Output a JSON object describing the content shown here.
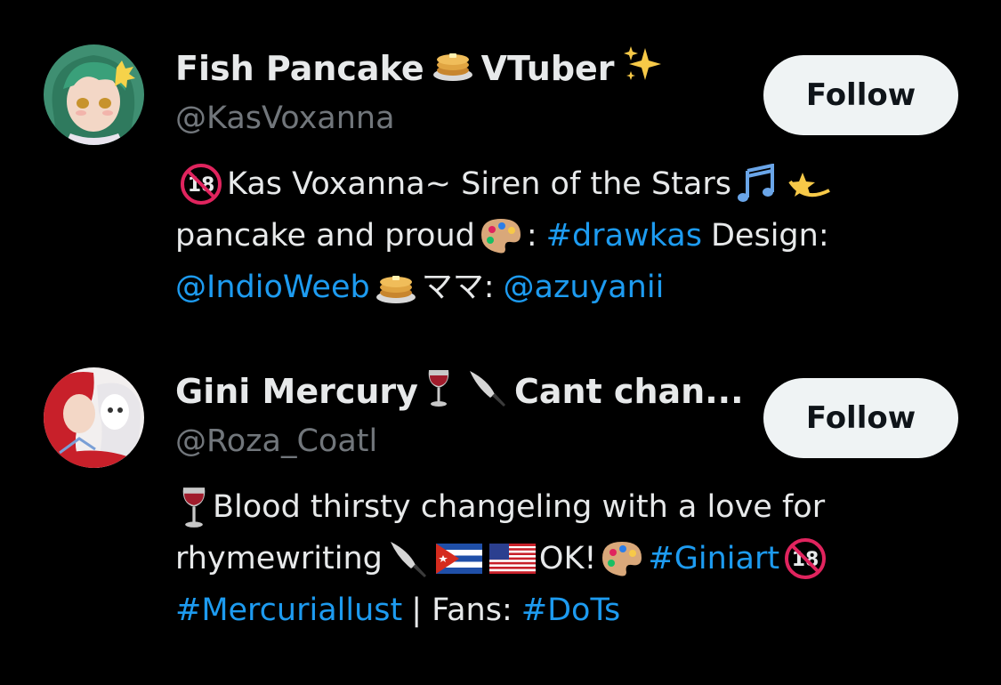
{
  "users": [
    {
      "name_part1": "Fish Pancake",
      "name_part2": "VTuber",
      "name_emoji": [
        "pancake-icon",
        "sparkles-icon"
      ],
      "handle": "@KasVoxanna",
      "follow_label": "Follow",
      "bio": {
        "l1_text": "Kas Voxanna~ Siren of the Stars",
        "l2_text": "pancake and proud",
        "l2_colon": ":",
        "l2_hashtag": "#drawkas",
        "l2_tail": "Design:",
        "l3_mention1": "@IndioWeeb",
        "l3_mama": "ママ:",
        "l3_mention2": "@azuyanii"
      }
    },
    {
      "name_part1": "Gini Mercury",
      "name_part2": "Cant chan...",
      "name_emoji": [
        "wine-glass-icon",
        "knife-icon"
      ],
      "handle": "@Roza_Coatl",
      "follow_label": "Follow",
      "bio": {
        "l1_text": "Blood thirsty changeling with a love for",
        "l2_text": "rhymewriting",
        "l2_ok": "OK!",
        "l2_hashtag": "#Giniart",
        "l3_hashtag1": "#Mercuriallust",
        "l3_sep": "| Fans:",
        "l3_hashtag2": "#DoTs"
      }
    }
  ],
  "colors": {
    "background": "#000000",
    "text": "#e7e9ea",
    "muted": "#71767b",
    "link": "#1d9bf0",
    "button_bg": "#eff3f4",
    "button_text": "#0f1419"
  }
}
